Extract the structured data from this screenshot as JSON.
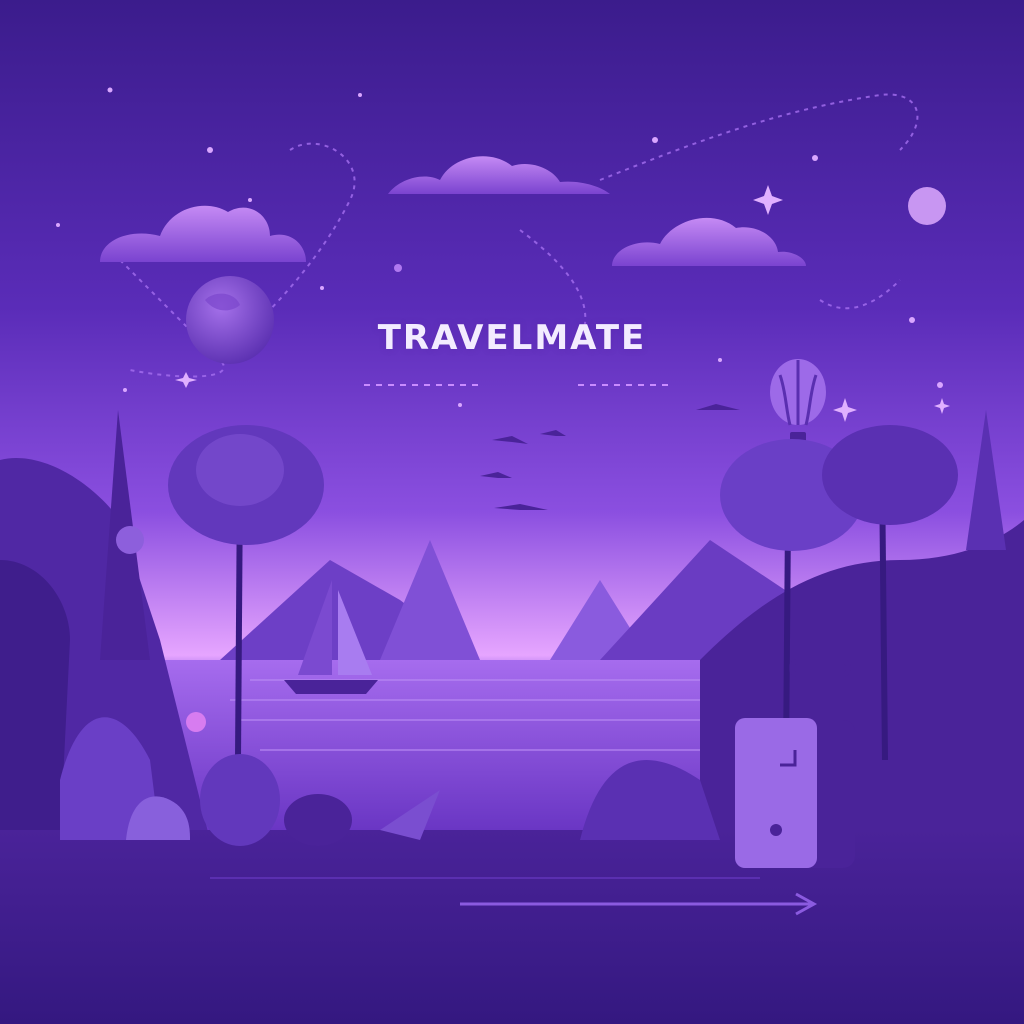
{
  "brand": {
    "title": "TRAVELMATE"
  },
  "colors": {
    "sky_top": "#3b1c8c",
    "sky_mid": "#7a40d8",
    "horizon_glow": "#e6a5ff",
    "mountain": "#7b4ad0",
    "mountain_dark": "#5a2fb0",
    "water": "#8a55dc",
    "foliage": "#4b2499",
    "foliage_dark": "#351878",
    "accent": "#c98cff",
    "ground": "#3a1d8c"
  },
  "icons": [
    "planet-icon",
    "moon-icon",
    "hot-air-balloon-icon",
    "sailboat-icon",
    "suitcase-icon",
    "arrow-right-icon",
    "sparkle-icon",
    "bird-icon"
  ]
}
